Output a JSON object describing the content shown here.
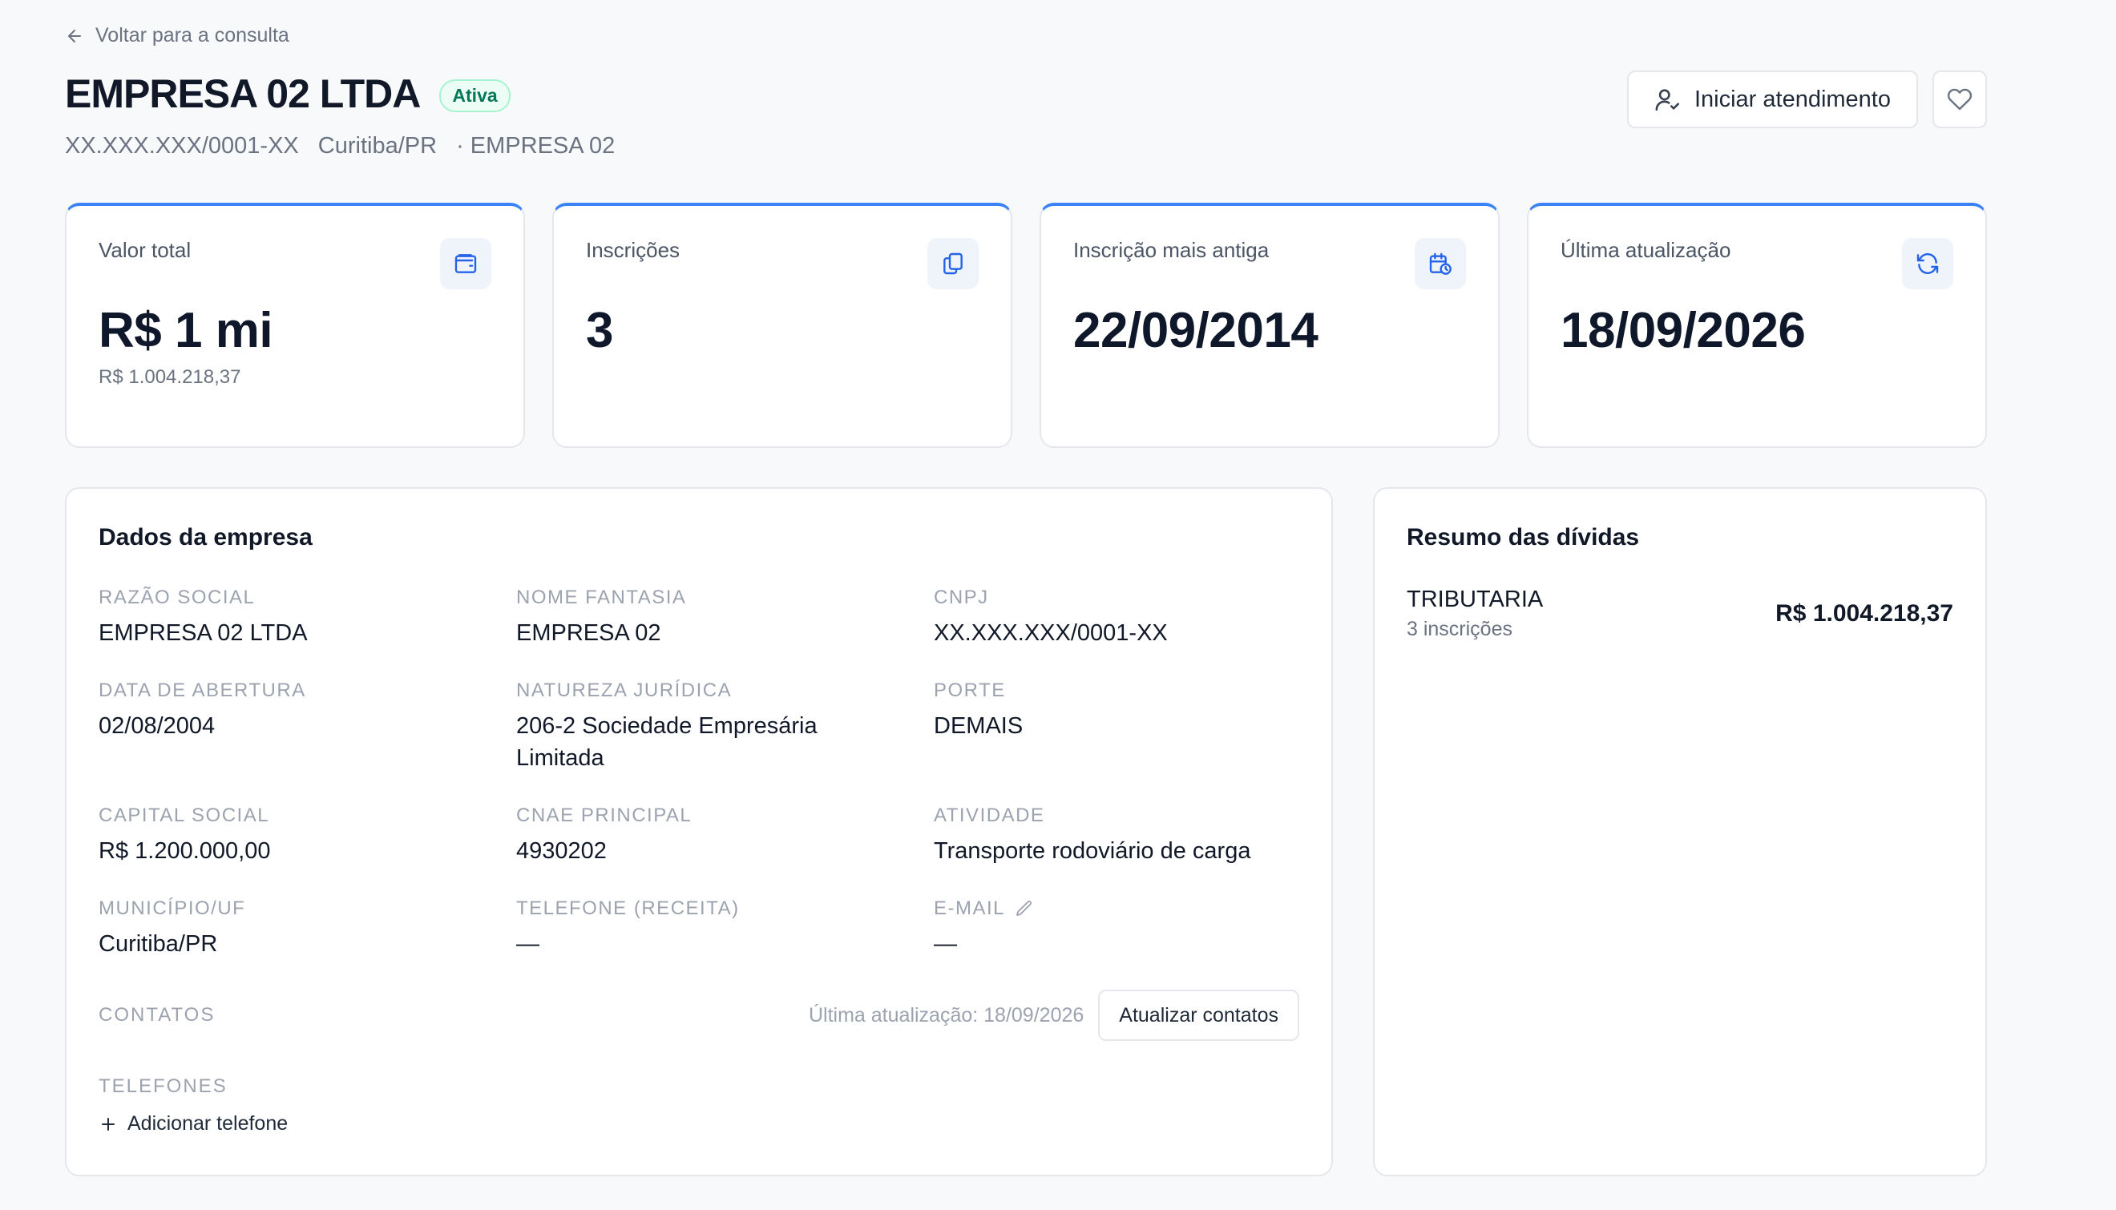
{
  "back": {
    "label": "Voltar para a consulta"
  },
  "header": {
    "title": "EMPRESA 02 LTDA",
    "status": "Ativa",
    "cnpj": "XX.XXX.XXX/0001-XX",
    "city": "Curitiba/PR",
    "trade_name": "· EMPRESA 02",
    "start_service_label": "Iniciar atendimento"
  },
  "stats": [
    {
      "label": "Valor total",
      "value": "R$ 1 mi",
      "sub": "R$ 1.004.218,37",
      "icon": "wallet-icon"
    },
    {
      "label": "Inscrições",
      "value": "3",
      "sub": "",
      "icon": "copy-files-icon"
    },
    {
      "label": "Inscrição mais antiga",
      "value": "22/09/2014",
      "sub": "",
      "icon": "calendar-clock-icon"
    },
    {
      "label": "Última atualização",
      "value": "18/09/2026",
      "sub": "",
      "icon": "refresh-icon"
    }
  ],
  "company": {
    "title": "Dados da empresa",
    "fields": {
      "razao_social": {
        "label": "RAZÃO SOCIAL",
        "value": "EMPRESA 02 LTDA"
      },
      "nome_fantasia": {
        "label": "NOME FANTASIA",
        "value": "EMPRESA 02"
      },
      "cnpj": {
        "label": "CNPJ",
        "value": "XX.XXX.XXX/0001-XX"
      },
      "data_abertura": {
        "label": "DATA DE ABERTURA",
        "value": "02/08/2004"
      },
      "natureza_juridica": {
        "label": "NATUREZA JURÍDICA",
        "value": "206-2 Sociedade Empresária Limitada"
      },
      "porte": {
        "label": "PORTE",
        "value": "DEMAIS"
      },
      "capital_social": {
        "label": "CAPITAL SOCIAL",
        "value": "R$ 1.200.000,00"
      },
      "cnae": {
        "label": "CNAE PRINCIPAL",
        "value": "4930202"
      },
      "atividade": {
        "label": "ATIVIDADE",
        "value": "Transporte rodoviário de carga"
      },
      "municipio": {
        "label": "MUNICÍPIO/UF",
        "value": "Curitiba/PR"
      },
      "telefone": {
        "label": "TELEFONE (RECEITA)",
        "value": "—"
      },
      "email": {
        "label": "E-MAIL",
        "value": "—"
      }
    },
    "contacts_label": "CONTATOS",
    "contacts_updated": "Última atualização: 18/09/2026",
    "update_contacts_label": "Atualizar contatos",
    "phones_label": "TELEFONES",
    "add_phone_label": "Adicionar telefone"
  },
  "debts": {
    "title": "Resumo das dívidas",
    "items": [
      {
        "name": "TRIBUTARIA",
        "count": "3 inscrições",
        "value": "R$ 1.004.218,37"
      }
    ]
  },
  "colors": {
    "accent": "#3b82f6",
    "status_green": "#047857",
    "background": "#f7f9fb"
  }
}
